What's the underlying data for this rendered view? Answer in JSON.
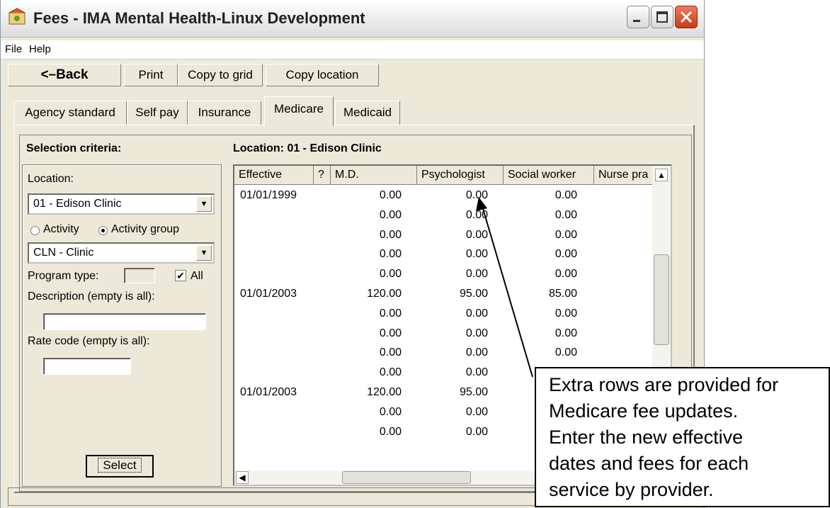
{
  "window": {
    "title": "Fees - IMA Mental Health-Linux Development"
  },
  "menu": [
    "File",
    "Help"
  ],
  "toolbar": {
    "back": "<–Back",
    "print": "Print",
    "copy_to_grid": "Copy to grid",
    "copy_location": "Copy location"
  },
  "tabs": [
    "Agency standard",
    "Self pay",
    "Insurance",
    "Medicare",
    "Medicaid"
  ],
  "active_tab": "Medicare",
  "criteria": {
    "heading": "Selection criteria:",
    "location_label": "Location:",
    "location_value": "01 - Edison Clinic",
    "radio_activity": "Activity",
    "radio_activity_group": "Activity group",
    "group_value": "CLN - Clinic",
    "program_type_label": "Program type:",
    "all_label": "All",
    "description_label": "Description (empty is all):",
    "rate_code_label": "Rate code (empty is all):",
    "select_button": "Select"
  },
  "grid": {
    "heading": "Location: 01 - Edison Clinic",
    "columns": [
      "Effective",
      "?",
      "M.D.",
      "Psychologist",
      "Social worker",
      "Nurse pra"
    ],
    "rows": [
      [
        "01/01/1999",
        "0.00",
        "0.00",
        "0.00"
      ],
      [
        "",
        "0.00",
        "0.00",
        "0.00"
      ],
      [
        "",
        "0.00",
        "0.00",
        "0.00"
      ],
      [
        "",
        "0.00",
        "0.00",
        "0.00"
      ],
      [
        "",
        "0.00",
        "0.00",
        "0.00"
      ],
      [
        "01/01/2003",
        "120.00",
        "95.00",
        "85.00"
      ],
      [
        "",
        "0.00",
        "0.00",
        "0.00"
      ],
      [
        "",
        "0.00",
        "0.00",
        "0.00"
      ],
      [
        "",
        "0.00",
        "0.00",
        "0.00"
      ],
      [
        "",
        "0.00",
        "0.00",
        ""
      ],
      [
        "01/01/2003",
        "120.00",
        "95.00",
        ""
      ],
      [
        "",
        "0.00",
        "0.00",
        ""
      ],
      [
        "",
        "0.00",
        "0.00",
        ""
      ]
    ]
  },
  "callout": {
    "lines": [
      "Extra rows are provided for",
      "Medicare fee updates.",
      "Enter the new effective",
      "dates and fees for each",
      "service by provider."
    ]
  }
}
